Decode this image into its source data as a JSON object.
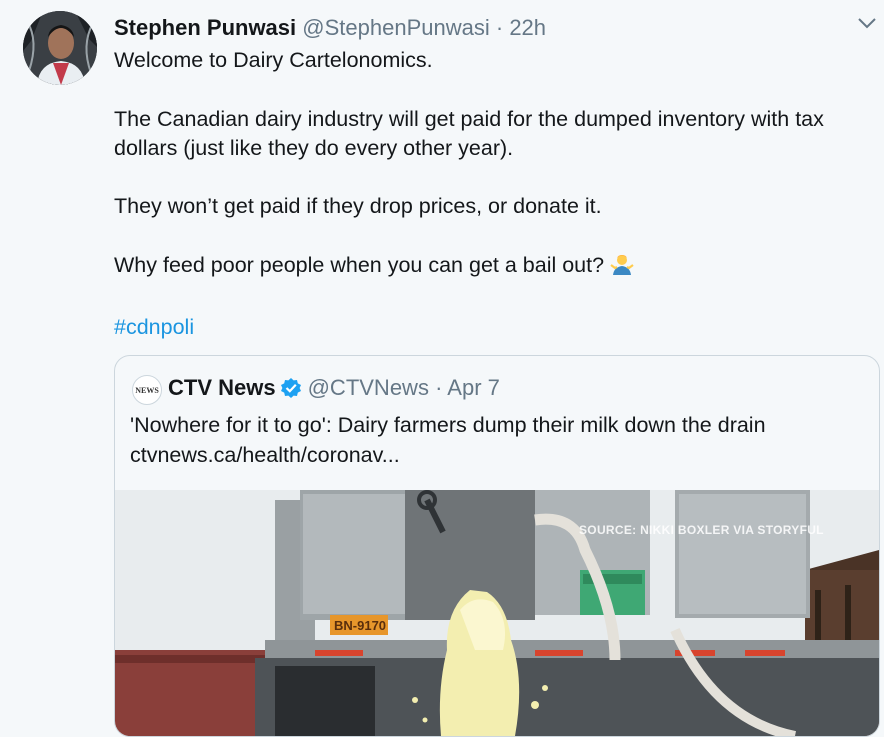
{
  "tweet": {
    "name": "Stephen Punwasi",
    "handle": "@StephenPunwasi",
    "dot": "·",
    "time": "22h",
    "lines": [
      "Welcome to Dairy Cartelonomics.",
      "The Canadian dairy industry will get paid for the dumped inventory with tax dollars (just like they do every other year).",
      "They won’t get paid if they drop prices, or donate it.",
      "Why feed poor people when you can get a bail out?"
    ],
    "emoji": "person-shrugging-emoji",
    "hashtag": "#cdnpoli"
  },
  "quoted": {
    "logo_text": "NEWS",
    "name": "CTV News",
    "handle": "@CTVNews",
    "dot": "·",
    "time": "Apr 7",
    "text": "'Nowhere for it to go': Dairy farmers dump their milk down the drain",
    "link": "ctvnews.ca/health/coronav...",
    "media_caption": "SOURCE: NIKKI BOXLER VIA STORYFUL",
    "plate_text": "BN-9170"
  },
  "colors": {
    "link": "#1b95e0",
    "text": "#14171a",
    "secondary": "#657786",
    "verified": "#1da1f2"
  }
}
